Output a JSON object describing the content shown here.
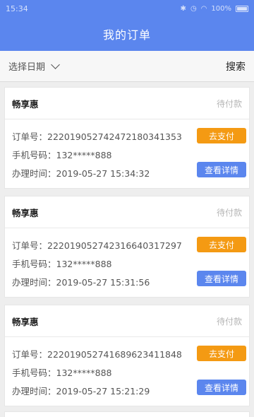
{
  "status_bar": {
    "time": "15:34",
    "battery": "100%"
  },
  "header": {
    "title": "我的订单"
  },
  "filter": {
    "date_label": "选择日期",
    "search_label": "搜索"
  },
  "labels": {
    "order_no": "订单号：",
    "phone": "手机号码：",
    "time": "办理时间："
  },
  "orders": [
    {
      "name": "畅享惠",
      "status": "待付款",
      "order_no": "2220190527424721803413​53",
      "phone": "132*****888",
      "time": "2019-05-27 15:34:32",
      "pay_label": "去支付",
      "detail_label": "查看详情"
    },
    {
      "name": "畅享惠",
      "status": "待付款",
      "order_no": "222019052742316640317297",
      "phone": "132*****888",
      "time": "2019-05-27 15:31:56",
      "pay_label": "去支付",
      "detail_label": "查看详情"
    },
    {
      "name": "畅享惠",
      "status": "待付款",
      "order_no": "222019052741689623411848",
      "phone": "132*****888",
      "time": "2019-05-27 15:21:29",
      "pay_label": "去支付",
      "detail_label": "查看详情"
    }
  ],
  "colors": {
    "header": "#5b86ee",
    "pay_button": "#f49a13",
    "detail_button": "#5b86ee"
  }
}
